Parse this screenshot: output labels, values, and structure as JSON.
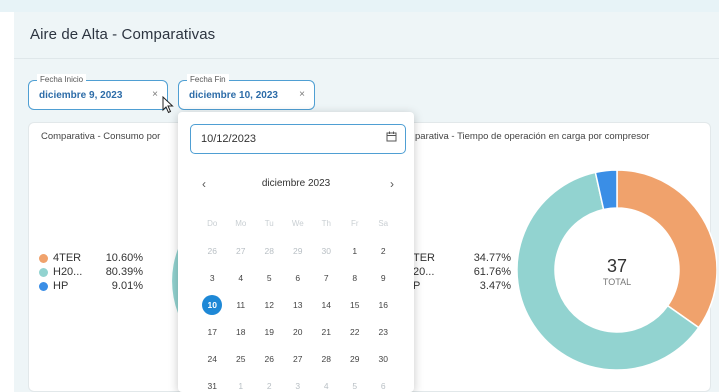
{
  "page": {
    "title": "Aire de Alta - Comparativas"
  },
  "filters": {
    "start": {
      "label": "Fecha Inicio",
      "value": "diciembre 9, 2023",
      "clear": "×"
    },
    "end": {
      "label": "Fecha Fin",
      "value": "diciembre 10, 2023",
      "clear": "×"
    }
  },
  "card1": {
    "title": "Comparativa - Consumo por",
    "legend": [
      {
        "name": "4TER",
        "pct": "10.60%",
        "color": "#f0a26c"
      },
      {
        "name": "H20...",
        "pct": "80.39%",
        "color": "#92d3d0"
      },
      {
        "name": "HP",
        "pct": "9.01%",
        "color": "#3a8ee6"
      }
    ]
  },
  "card2": {
    "title": "parativa - Tiempo de operación en carga por compresor",
    "legend": [
      {
        "name": "TER",
        "pct": "34.77%"
      },
      {
        "name": "20...",
        "pct": "61.76%"
      },
      {
        "name": "P",
        "pct": "3.47%"
      }
    ],
    "donut": {
      "total": "37",
      "total_label": "TOTAL",
      "slices": [
        {
          "value": 34.77,
          "color": "#f0a26c"
        },
        {
          "value": 61.76,
          "color": "#92d3d0"
        },
        {
          "value": 3.47,
          "color": "#3a8ee6"
        }
      ]
    }
  },
  "calendar": {
    "input": "10/12/2023",
    "month": "diciembre 2023",
    "prev": "‹",
    "next": "›",
    "weekdays": [
      "Do",
      "Mo",
      "Tu",
      "We",
      "Th",
      "Fr",
      "Sa"
    ],
    "weeks": [
      [
        "26",
        "27",
        "28",
        "29",
        "30",
        "1",
        "2"
      ],
      [
        "3",
        "4",
        "5",
        "6",
        "7",
        "8",
        "9"
      ],
      [
        "10",
        "11",
        "12",
        "13",
        "14",
        "15",
        "16"
      ],
      [
        "17",
        "18",
        "19",
        "20",
        "21",
        "22",
        "23"
      ],
      [
        "24",
        "25",
        "26",
        "27",
        "28",
        "29",
        "30"
      ],
      [
        "31",
        "1",
        "2",
        "3",
        "4",
        "5",
        "6"
      ]
    ],
    "selected": "10"
  }
}
